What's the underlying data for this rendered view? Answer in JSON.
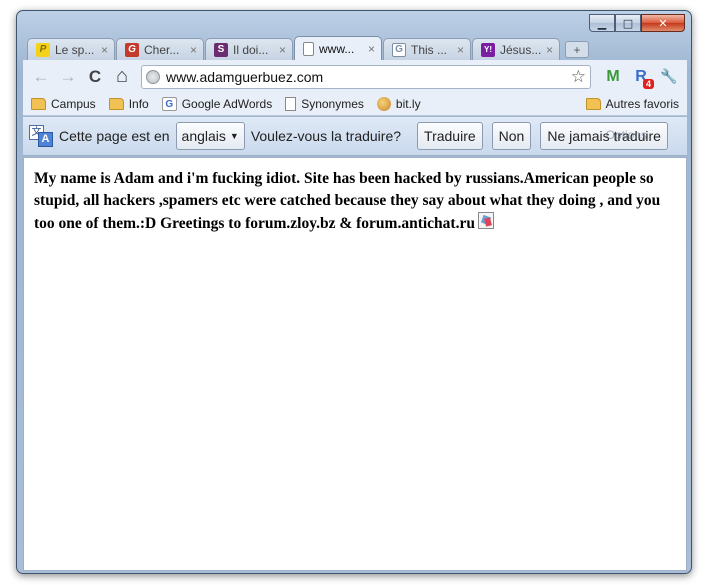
{
  "window": {
    "controls": {
      "minimize": "▁",
      "maximize": "□",
      "close": "✕"
    }
  },
  "tabs": [
    {
      "title": "Le sp...",
      "icon": "P",
      "icon_color": "#f2d21b",
      "active": false
    },
    {
      "title": "Cher...",
      "icon": "G",
      "icon_color": "#c43a2c",
      "active": false
    },
    {
      "title": "Il doi...",
      "icon": "S",
      "icon_color": "#6b2d6f",
      "active": false
    },
    {
      "title": "www...",
      "icon": "page-icon",
      "active": true
    },
    {
      "title": "This ...",
      "icon": "G",
      "icon_color": "#7c8ea6",
      "active": false
    },
    {
      "title": "Jésus...",
      "icon": "Y!",
      "icon_color": "#7b1fa2",
      "active": false
    }
  ],
  "tab_close": "×",
  "new_tab": "+",
  "toolbar": {
    "back": "←",
    "forward": "→",
    "reload": "C",
    "home": "⌂",
    "url": "www.adamguerbuez.com",
    "star": "☆",
    "gmail": "M",
    "reader": "R",
    "reader_badge": "4",
    "wrench": "🔧"
  },
  "bookmarks": [
    {
      "label": "Campus",
      "icon": "folder-icon"
    },
    {
      "label": "Info",
      "icon": "folder-icon"
    },
    {
      "label": "Google AdWords",
      "icon": "google-icon"
    },
    {
      "label": "Synonymes",
      "icon": "page-icon"
    },
    {
      "label": "bit.ly",
      "icon": "bitly-icon"
    }
  ],
  "bookmarks_other": "Autres favoris",
  "translate_bar": {
    "prefix": "Cette page est en",
    "language": "anglais",
    "question": "Voulez-vous la traduire?",
    "translate": "Traduire",
    "no": "Non",
    "never": "Ne jamais traduire",
    "options": "Options"
  },
  "page": {
    "body": "My name is Adam and i'm fucking idiot. Site has been hacked by russians.American people so stupid, all hackers ,spamers etc were catched because they say about what they doing , and you too one of them.:D Greetings to forum.zloy.bz & forum.antichat.ru"
  }
}
